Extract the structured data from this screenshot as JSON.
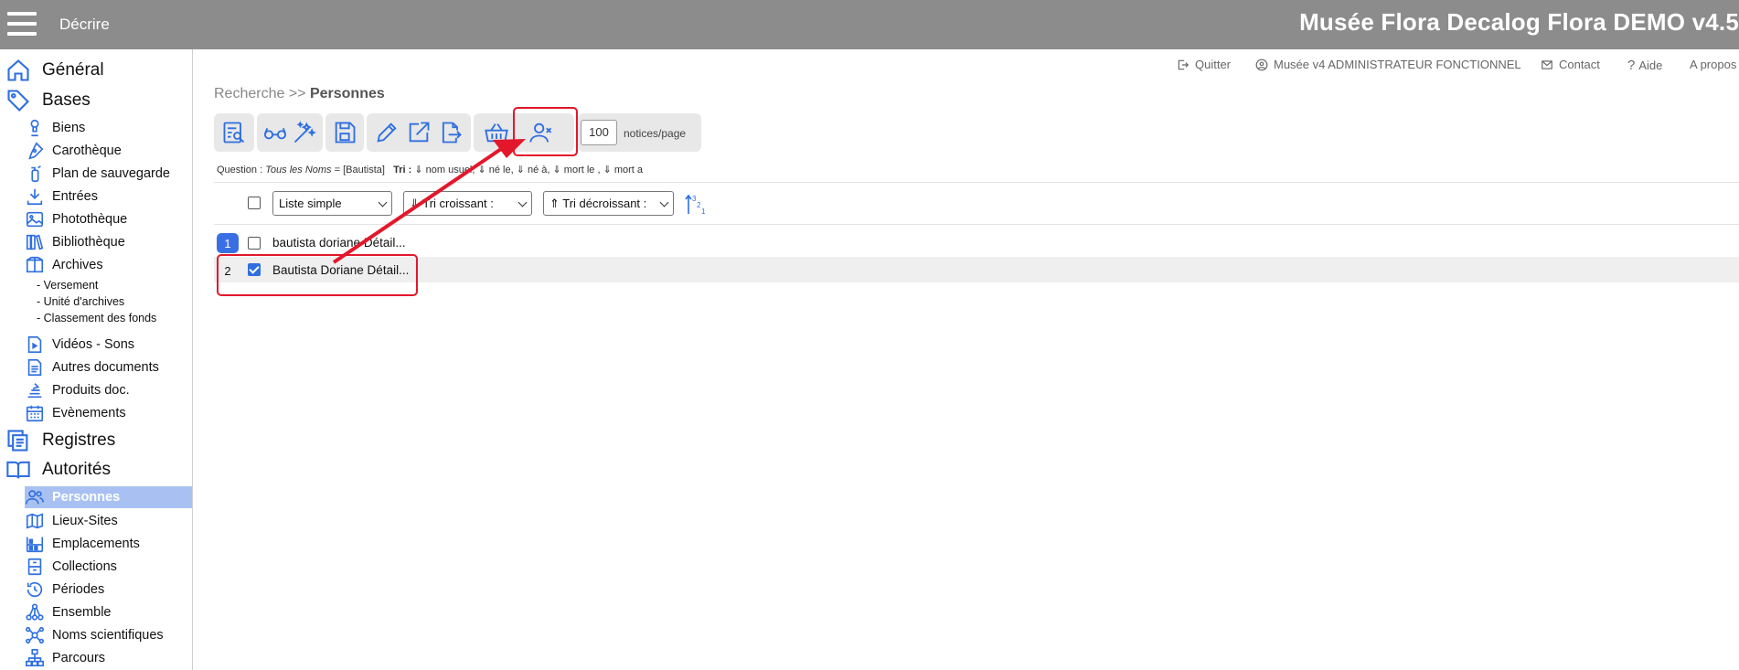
{
  "header": {
    "menu_icon": "hamburger-icon",
    "decrire": "Décrire",
    "title": "Musée Flora Decalog Flora DEMO v4.5"
  },
  "sidebar": {
    "general": "Général",
    "bases": "Bases",
    "bases_items": [
      "Biens",
      "Carothèque",
      "Plan de sauvegarde",
      "Entrées",
      "Photothèque",
      "Bibliothèque",
      "Archives"
    ],
    "archives_sub": [
      "- Versement",
      "- Unité d'archives",
      "- Classement des fonds"
    ],
    "bases_items2": [
      "Vidéos - Sons",
      "Autres documents",
      "Produits doc.",
      "Evènements"
    ],
    "registres": "Registres",
    "autorites": "Autorités",
    "autorites_items": [
      "Personnes",
      "Lieux-Sites",
      "Emplacements",
      "Collections",
      "Périodes",
      "Ensemble",
      "Noms scientifiques",
      "Parcours"
    ]
  },
  "util": {
    "quitter": "Quitter",
    "user": "Musée v4 ADMINISTRATEUR FONCTIONNEL",
    "contact": "Contact",
    "aide": "Aide",
    "apropos": "A propos"
  },
  "breadcrumb": {
    "root": "Recherche >> ",
    "current": "Personnes"
  },
  "toolbar": {
    "per_page_value": "100",
    "per_page_label": "notices/page"
  },
  "question": {
    "prefix": "Question : ",
    "field": "Tous les Noms",
    "rest": " = [Bautista]",
    "tri_label": "Tri :",
    "tri_rest": " ⇓ nom usuel, ⇓ né le, ⇓ né à, ⇓ mort le , ⇓ mort a"
  },
  "controls": {
    "view": "Liste simple",
    "tri_asc": "⇓ Tri croissant :",
    "tri_desc": "⇑ Tri décroissant :"
  },
  "results": [
    {
      "num": "1",
      "text": "bautista doriane Détail...",
      "checked": false
    },
    {
      "num": "2",
      "text": "Bautista Doriane Détail...",
      "checked": true
    }
  ],
  "colors": {
    "accent": "#2f6fe0",
    "header_bg": "#8c8c8c",
    "annotation": "#e3172b"
  }
}
